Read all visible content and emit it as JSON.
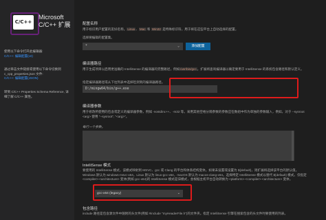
{
  "header": {
    "logo_text": "C/C++",
    "title_line1": "Microsoft",
    "title_line2": "C/C++ 扩展"
  },
  "sidebar": {
    "p1": "使用以下命令打开此编辑器:",
    "p1_link": "C/C++: 编辑配置(UI)",
    "p2": "通过单击文件链接或使用以下命令切换到 c_cpp_properties.json 文件:",
    "p2_link": "C/C++: 编辑配置(JSON)",
    "p3": "转到 C/C++ Properties Schema Reference, 详细了解 C/C++ 属性。"
  },
  "config_name": {
    "heading": "配置名称",
    "desc_a": "用于标识用户配置的友好名称。",
    "tag1": "Linux",
    "sep": "、",
    "tag2": "Mac",
    "desc_and": " 和 ",
    "tag3": "Win32",
    "desc_b": " 是特殊标识符，用于将在这些平台上自动选择的配置。",
    "sub": "选择要编辑的配置集。",
    "select_value": "*",
    "add_button": "添加配置"
  },
  "compiler_path": {
    "heading": "编译器路径",
    "desc1_a": "用于生成项目以启用更准确的 IntelliSense 的编译器的完整路径，例如",
    "desc1_tag": "/usr/bin/gcc",
    "desc1_b": "。扩展将查询编译器以确定要用于 IntelliSense 的系统包含路径和默认定义。",
    "sub": "指定编译器路径或从下拉列表中选择检测到的编译器路径。",
    "value": "D:/mingw64/bin/g++.exe"
  },
  "compiler_args": {
    "heading": "编译器参数",
    "desc": "用于修改所使用的包含或定义的编译器参数，例如 -nostdinc++、-m32 等。采用其他空格分隔参数的参数应在数组中作为单独的参数输入，例如，对于 --sysroot <arg> 使用 \"--sysroot\", \"<arg>\"。",
    "placeholder": "每行一个参数。"
  },
  "intellisense_mode": {
    "heading": "IntelliSense 模式",
    "desc": "要使用的 IntelliSense 模式，该模式映射到 MSVC、gcc 或 Clang 的平台和体系结构变体。如果未设置或设置为 ${default}，则扩展将选择该平台的默认值。Windows 默认为 windows-msvc-x64，Linux 默认为 linux-gcc-x64，macOS 默认为 macos-clang-x64。选择特定 IntelliSense 模式以替代 ${default} 模式。仅指定 <compiler>-<architecture> 变体(例如 gcc-x64)的 IntelliSense 模式是旧模式，会根据主机平台自动转换为 <platform>-<compiler>-<architecture> 变体。",
    "value": "gcc-x64 (legacy)"
  },
  "include_path": {
    "heading": "包含路径",
    "desc": "include 路径是包含源文件中随附的头文件(例如 #include \"myHeaderFile.h\")的文件夹。指定 IntelliSense 引擎在搜索包含的头文件时要使用的列表。"
  }
}
